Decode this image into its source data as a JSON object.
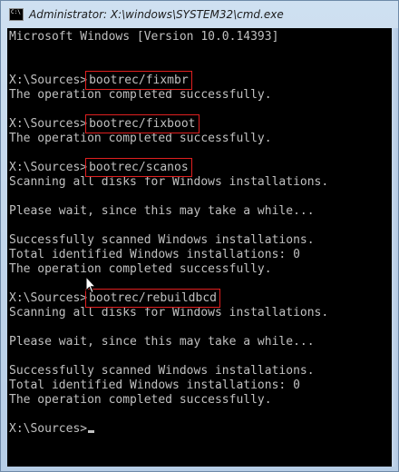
{
  "window": {
    "title": "Administrator: X:\\windows\\SYSTEM32\\cmd.exe"
  },
  "icons": {
    "app": "cmd-icon",
    "pointer": "mouse-pointer-icon"
  },
  "console": {
    "lines": [
      {
        "text": "Microsoft Windows [Version 10.0.14393]"
      },
      {
        "text": ""
      },
      {
        "text": ""
      },
      {
        "prompt": "X:\\Sources>",
        "command": "bootrec/fixmbr"
      },
      {
        "text": "The operation completed successfully."
      },
      {
        "text": ""
      },
      {
        "prompt": "X:\\Sources>",
        "command": "bootrec/fixboot"
      },
      {
        "text": "The operation completed successfully."
      },
      {
        "text": ""
      },
      {
        "prompt": "X:\\Sources>",
        "command": "bootrec/scanos"
      },
      {
        "text": "Scanning all disks for Windows installations."
      },
      {
        "text": ""
      },
      {
        "text": "Please wait, since this may take a while..."
      },
      {
        "text": ""
      },
      {
        "text": "Successfully scanned Windows installations."
      },
      {
        "text": "Total identified Windows installations: 0"
      },
      {
        "text": "The operation completed successfully."
      },
      {
        "text": ""
      },
      {
        "prompt": "X:\\Sources>",
        "command": "bootrec/rebuildbcd"
      },
      {
        "text": "Scanning all disks for Windows installations."
      },
      {
        "text": ""
      },
      {
        "text": "Please wait, since this may take a while..."
      },
      {
        "text": ""
      },
      {
        "text": "Successfully scanned Windows installations."
      },
      {
        "text": "Total identified Windows installations: 0"
      },
      {
        "text": "The operation completed successfully."
      },
      {
        "text": ""
      },
      {
        "prompt": "X:\\Sources>",
        "cursor": true
      }
    ]
  }
}
